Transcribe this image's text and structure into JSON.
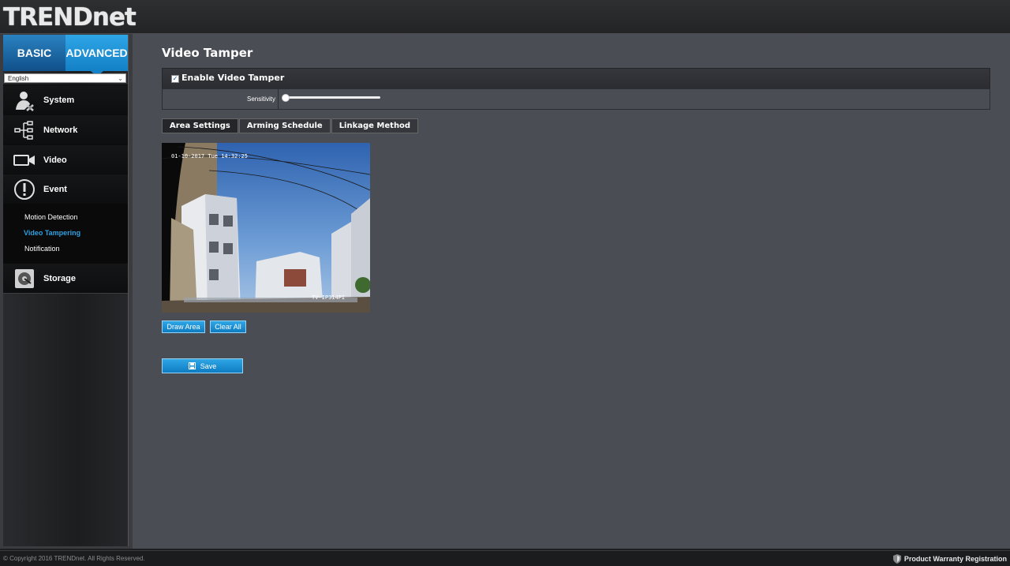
{
  "brand": {
    "logo": "TRENDnet"
  },
  "sidebar": {
    "mode_tabs": [
      "BASIC",
      "ADVANCED"
    ],
    "language": "English",
    "items": [
      {
        "label": "System",
        "icon": "user-settings-icon"
      },
      {
        "label": "Network",
        "icon": "network-icon"
      },
      {
        "label": "Video",
        "icon": "video-camera-icon"
      },
      {
        "label": "Event",
        "icon": "alert-icon"
      },
      {
        "label": "Storage",
        "icon": "storage-disk-icon"
      }
    ],
    "event_submenu": [
      "Motion Detection",
      "Video Tampering",
      "Notification"
    ],
    "active_subitem": "Video Tampering"
  },
  "main": {
    "title": "Video Tamper",
    "enable_label": "Enable Video Tamper",
    "enable_checked": true,
    "sensitivity_label": "Sensitivity",
    "sensitivity_value": 0,
    "tabs": [
      "Area Settings",
      "Arming Schedule",
      "Linkage Method"
    ],
    "active_tab": "Area Settings",
    "video": {
      "timestamp": "01-10-2017 Tue 14:32:25",
      "camera_name": "TV-IP314PI"
    },
    "draw_area_label": "Draw Area",
    "clear_all_label": "Clear All",
    "save_label": "Save"
  },
  "footer": {
    "copyright": "© Copyright 2016 TRENDnet. All Rights Reserved.",
    "warranty": "Product Warranty Registration"
  },
  "colors": {
    "accent": "#1a8fd8",
    "active_subitem": "#2ea0e0",
    "content_bg": "#4b4d55"
  }
}
